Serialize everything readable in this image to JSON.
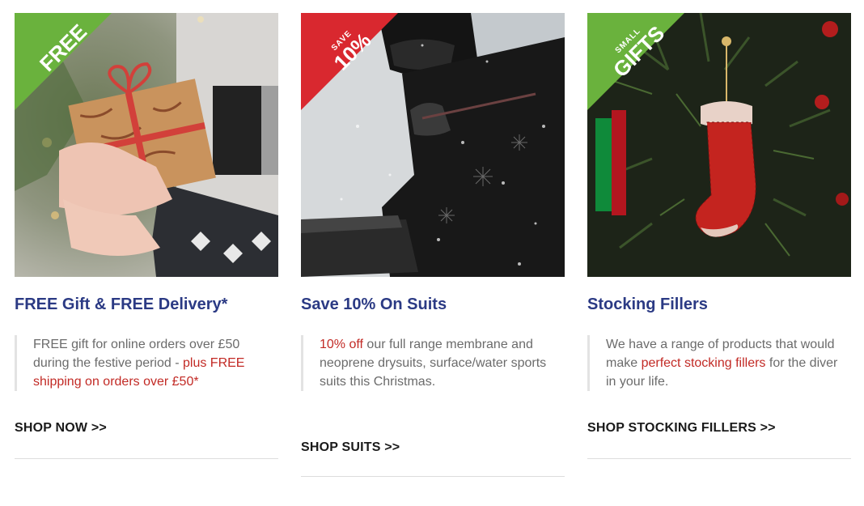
{
  "colors": {
    "title": "#2b3a84",
    "highlight": "#c22a25",
    "body_text": "#6b6b6b",
    "ribbon_green": "#6ab23d",
    "ribbon_red": "#d9282f",
    "link": "#1a1a1a"
  },
  "cards": [
    {
      "ribbon": {
        "small": "",
        "big": "FREE"
      },
      "title": "FREE Gift & FREE Delivery*",
      "desc": {
        "part1": "FREE gift for online orders over £50 during the festive period - ",
        "highlight1": "plus FREE shipping on orders over £50*",
        "part2": ""
      },
      "link": "SHOP NOW >>"
    },
    {
      "ribbon": {
        "small": "SAVE",
        "big": "10%"
      },
      "title": "Save 10% On Suits",
      "desc": {
        "highlight1": "10% off",
        "part1": " our full range membrane and neoprene drysuits, surface/water sports suits this Christmas."
      },
      "link": "SHOP SUITS >>"
    },
    {
      "ribbon": {
        "small": "SMALL",
        "big": "GIFTS"
      },
      "title": "Stocking Fillers",
      "desc": {
        "part1": "We have a range of products that would make ",
        "highlight1": "perfect stocking fillers",
        "part2": " for the diver in your life."
      },
      "link": "SHOP STOCKING FILLERS >>"
    }
  ]
}
